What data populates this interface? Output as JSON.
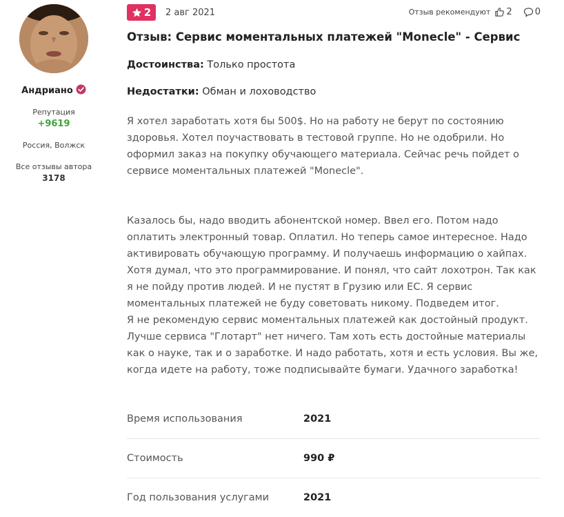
{
  "author": {
    "name": "Андриано",
    "reputation_label": "Репутация",
    "reputation_value": "+9619",
    "location": "Россия, Волжск",
    "all_reviews_label": "Все отзывы автора",
    "all_reviews_count": "3178"
  },
  "review": {
    "rating": "2",
    "date": "2 авг 2021",
    "recommend_label": "Отзыв рекомендуют",
    "likes": "2",
    "comments": "0",
    "title": "Отзыв: Сервис моментальных платежей \"Monecle\" - Сервис",
    "pros_label": "Достоинства:",
    "pros_text": "Только простота",
    "cons_label": "Недостатки:",
    "cons_text": "Обман и лоховодство",
    "body_1": "Я хотел заработать хотя бы 500$. Но на работу не берут по состоянию здоровья. Хотел поучаствовать в тестовой группе. Но не одобрили. Но оформил заказ на покупку обучающего материала. Сейчас речь пойдет о сервисе моментальных платежей \"Monecle\".",
    "body_2": "Казалось бы, надо вводить абонентской номер. Ввел его. Потом надо оплатить электронный товар. Оплатил. Но теперь самое интересное. Надо активировать обучающую программу. И получаешь информацию о хайпах. Хотя думал, что это программирование. И понял, что сайт лохотрон. Так как я не пойду против людей. И не пустят в Грузию или ЕС. Я сервис моментальных платежей не буду советовать никому. Подведем итог.",
    "body_3": "Я не рекомендую сервис моментальных платежей как достойный продукт. Лучше сервиса \"Глотарт\" нет ничего. Там хоть есть достойные материалы как о науке, так и о заработке. И надо работать, хотя и есть условия. Вы же, когда идете на работу, тоже подписывайте бумаги. Удачного заработка!"
  },
  "properties": [
    {
      "label": "Время использования",
      "value": "2021"
    },
    {
      "label": "Стоимость",
      "value": "990 ₽"
    },
    {
      "label": "Год пользования услугами",
      "value": "2021"
    }
  ],
  "colors": {
    "rating_badge": "#e03162",
    "reputation": "#3da53a",
    "verified": "#c2386b"
  },
  "icons": {
    "rating": "star-icon",
    "verified": "verified-badge-icon",
    "likes": "thumbs-up-icon",
    "comments": "comment-bubble-icon"
  }
}
